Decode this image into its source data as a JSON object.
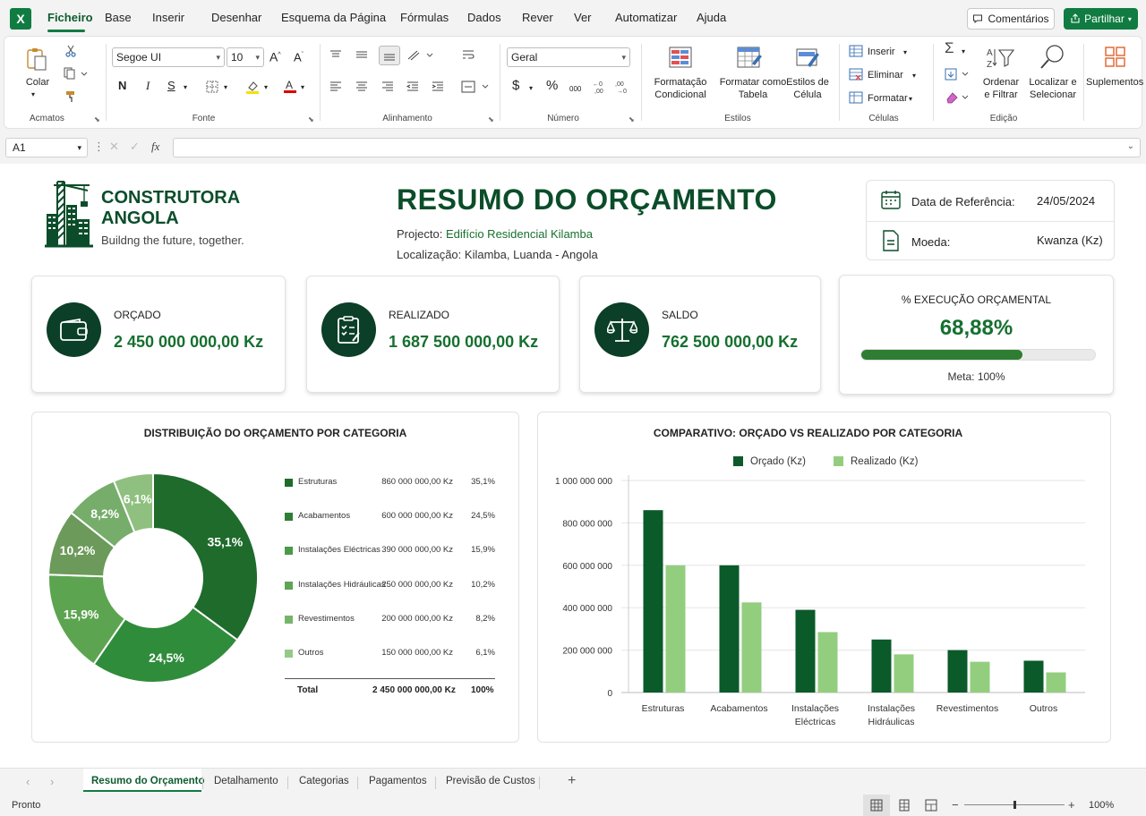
{
  "app": {
    "icon_letter": "X"
  },
  "menu": [
    "Ficheiro",
    "Base",
    "Inserir",
    "Desenhar",
    "Esquema da Página",
    "Fórmulas",
    "Dados",
    "Rever",
    "Ver",
    "Automatizar",
    "Ajuda"
  ],
  "actions": {
    "comments": "Comentários",
    "share": "Partilhar"
  },
  "ribbon": {
    "clipboard": {
      "paste": "Colar",
      "group": "Acmatos"
    },
    "font": {
      "name": "Segoe UI",
      "size": "10",
      "bold": "N",
      "italic": "I",
      "underline": "S",
      "group": "Fonte"
    },
    "alignment": {
      "group": "Alinhamento"
    },
    "number": {
      "format": "Geral",
      "currency": "$",
      "percent": "%",
      "thousands": "000",
      "group": "Número"
    },
    "styles": {
      "cond1": "Formatação",
      "cond2": "Condicional",
      "table1": "Formatar como",
      "table2": "Tabela",
      "cell1": "Estilos de",
      "cell2": "Célula",
      "group": "Estilos"
    },
    "cells": {
      "insert": "Inserir",
      "delete": "Eliminar",
      "format": "Formatar",
      "group": "Células"
    },
    "editing": {
      "sort1": "Ordenar",
      "sort2": "e Filtrar",
      "find1": "Localizar e",
      "find2": "Selecionar",
      "group": "Edição"
    },
    "addins": {
      "label": "Suplementos"
    }
  },
  "formula_bar": {
    "cell": "A1",
    "fx": "fx",
    "value": ""
  },
  "header": {
    "company_line1": "CONSTRUTORA",
    "company_line2": "ANGOLA",
    "tagline": "Buildng the future, together.",
    "title": "RESUMO DO ORÇAMENTO",
    "project_label": "Projecto:",
    "project_value": "Edifício Residencial Kilamba",
    "location_label": "Localização:",
    "location_value": "Kilamba, Luanda - Angola",
    "date_label": "Data de Referência:",
    "date_value": "24/05/2024",
    "currency_label": "Moeda:",
    "currency_value": "Kwanza (Kz)"
  },
  "kpis": {
    "budget": {
      "label": "ORÇADO",
      "value": "2 450 000 000,00 Kz"
    },
    "actual": {
      "label": "REALIZADO",
      "value": "1 687 500 000,00 Kz"
    },
    "balance": {
      "label": "SALDO",
      "value": "762 500 000,00 Kz"
    },
    "execution": {
      "label": "% EXECUÇÃO ORÇAMENTAL",
      "value": "68,88%",
      "progress": 0.6888,
      "target": "Meta: 100%"
    }
  },
  "colors": {
    "dark_green": "#0b4d2a",
    "brand_green": "#16702f",
    "accent": "#107c41"
  },
  "donut": {
    "title": "DISTRIBUIÇÃO DO ORÇAMENTO POR CATEGORIA",
    "total_label": "Total",
    "total_value": "2 450 000 000,00 Kz",
    "total_pct": "100%"
  },
  "bar": {
    "title": "COMPARATIVO: ORÇADO VS REALIZADO POR CATEGORIA"
  },
  "chart_data": [
    {
      "type": "pie",
      "title": "DISTRIBUIÇÃO DO ORÇAMENTO POR CATEGORIA",
      "categories": [
        "Estruturas",
        "Acabamentos",
        "Instalações Eléctricas",
        "Instalações Hidráulicas",
        "Revestimentos",
        "Outros"
      ],
      "values": [
        860000000,
        600000000,
        390000000,
        250000000,
        200000000,
        150000000
      ],
      "value_labels": [
        "860 000 000,00 Kz",
        "600 000 000,00 Kz",
        "390 000 000,00 Kz",
        "250 000 000,00 Kz",
        "200 000 000,00 Kz",
        "150 000 000,00 Kz"
      ],
      "percent_labels": [
        "35,1%",
        "24,5%",
        "15,9%",
        "10,2%",
        "8,2%",
        "6,1%"
      ],
      "colors": [
        "#1e6b2c",
        "#2f8c3b",
        "#5da451",
        "#6b9a5a",
        "#76ad6a",
        "#8fc07f"
      ],
      "legend_colors": [
        "#1e6b2c",
        "#2f7d38",
        "#4a9a48",
        "#5fa455",
        "#76b46a",
        "#95c988"
      ]
    },
    {
      "type": "bar",
      "title": "COMPARATIVO: ORÇADO VS REALIZADO POR CATEGORIA",
      "categories": [
        "Estruturas",
        "Acabamentos",
        "Instalações Eléctricas",
        "Instalações Hidráulicas",
        "Revestimentos",
        "Outros"
      ],
      "category_lines": [
        [
          "Estruturas"
        ],
        [
          "Acabamentos"
        ],
        [
          "Instalações",
          "Eléctricas"
        ],
        [
          "Instalações",
          "Hidráulicas"
        ],
        [
          "Revestimentos"
        ],
        [
          "Outros"
        ]
      ],
      "series": [
        {
          "name": "Orçado (Kz)",
          "color": "#0b5a2a",
          "values": [
            860000000,
            600000000,
            390000000,
            250000000,
            200000000,
            150000000
          ]
        },
        {
          "name": "Realizado (Kz)",
          "color": "#93ce7f",
          "values": [
            600000000,
            425000000,
            285000000,
            180000000,
            145000000,
            95000000
          ]
        }
      ],
      "ylim": [
        0,
        1000000000
      ],
      "yticks": [
        0,
        200000000,
        400000000,
        600000000,
        800000000,
        1000000000
      ],
      "ytick_labels": [
        "0",
        "200 000 000",
        "400 000 000",
        "600 000 000",
        "800 000 000",
        "1 000 000 000"
      ],
      "grid": true,
      "legend": "top"
    }
  ],
  "sheets": [
    "Resumo do Orçamento",
    "Detalhamento",
    "Categorias",
    "Pagamentos",
    "Previsão de Custos"
  ],
  "status": {
    "ready": "Pronto",
    "zoom": "100%",
    "zoom_level": 1.0
  }
}
